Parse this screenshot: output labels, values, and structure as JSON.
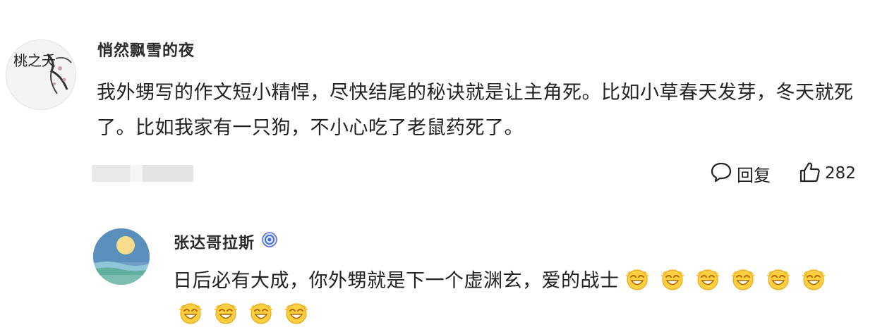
{
  "comment": {
    "user_name": "悄然飘雪的夜",
    "avatar_text": "桃之夭",
    "text": "我外甥写的作文短小精悍，尽快结尾的秘诀就是让主角死。比如小草春天发芽，冬天就死了。比如我家有一只狗，不小心吃了老鼠药死了。",
    "reply_label": "回复",
    "like_count": "282",
    "reply_icon": "comment-bubble-icon",
    "like_icon": "thumbs-up-icon"
  },
  "reply": {
    "user_name": "张达哥拉斯",
    "badge_icon": "verified-badge-icon",
    "text": "日后必有大成，你外甥就是下一个虚渊玄，爱的战士",
    "emoji_icon": "laughing-star-eyes-emoji",
    "emoji_count": 10
  },
  "colors": {
    "text": "#222222",
    "badge": "#4a6fd1"
  }
}
